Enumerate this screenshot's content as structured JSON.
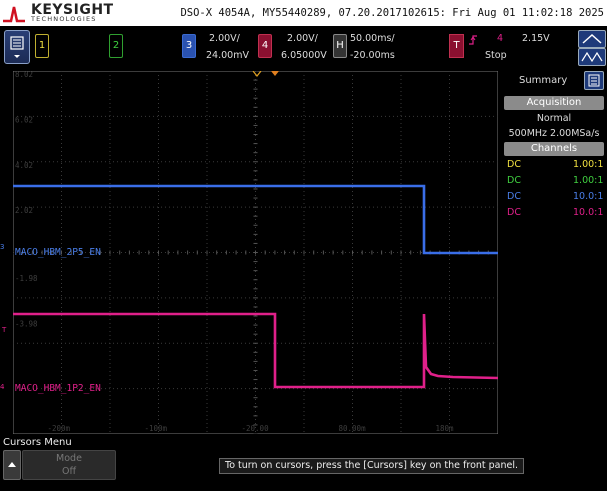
{
  "header": {
    "brand": "KEYSIGHT",
    "brand_sub": "TECHNOLOGIES",
    "info": "DSO-X 4054A, MY55440289, 07.20.2017102615: Fri Aug 01 11:02:18 2025"
  },
  "channels": [
    {
      "num": "1",
      "color": "#f0e040"
    },
    {
      "num": "2",
      "color": "#40d040"
    },
    {
      "num": "3",
      "color": "#4a7ee8",
      "scale": "2.00V/",
      "offset": "24.00mV"
    },
    {
      "num": "4",
      "color": "#e0208a",
      "scale": "2.00V/",
      "offset": "6.05000V"
    }
  ],
  "horizontal": {
    "key": "H",
    "scale": "50.00ms/",
    "delay": "-20.00ms"
  },
  "trigger": {
    "key": "T",
    "source": "4",
    "level": "2.15V",
    "status": "Stop"
  },
  "grid": {
    "y_labels": [
      "8.02",
      "6.02",
      "4.02",
      "2.02",
      "-1.98",
      "-3.98"
    ],
    "x_labels": [
      "-200m",
      "-100m",
      "-20.00",
      "80.00m",
      "180m"
    ],
    "trace3_label": "MACO_HBM_2P5_EN",
    "trace4_label": "MACO_HBM_1P2_EN",
    "marker_3": "3",
    "marker_4": "4",
    "marker_t": "T"
  },
  "right_panel": {
    "tab": "Summary",
    "acq_header": "Acquisition",
    "acq_mode": "Normal",
    "acq_rate": "500MHz  2.00MSa/s",
    "ch_header": "Channels",
    "rows": [
      {
        "coupling": "DC",
        "probe": "1.00:1",
        "color": "#f0e040"
      },
      {
        "coupling": "DC",
        "probe": "1.00:1",
        "color": "#40d040"
      },
      {
        "coupling": "DC",
        "probe": "10.0:1",
        "color": "#4a7ee8"
      },
      {
        "coupling": "DC",
        "probe": "10.0:1",
        "color": "#e0208a"
      }
    ]
  },
  "softkeys": {
    "menu_title": "Cursors Menu",
    "mode_label": "Mode",
    "mode_value": "Off",
    "message": "To turn on cursors, press the [Cursors] key on the front panel."
  }
}
